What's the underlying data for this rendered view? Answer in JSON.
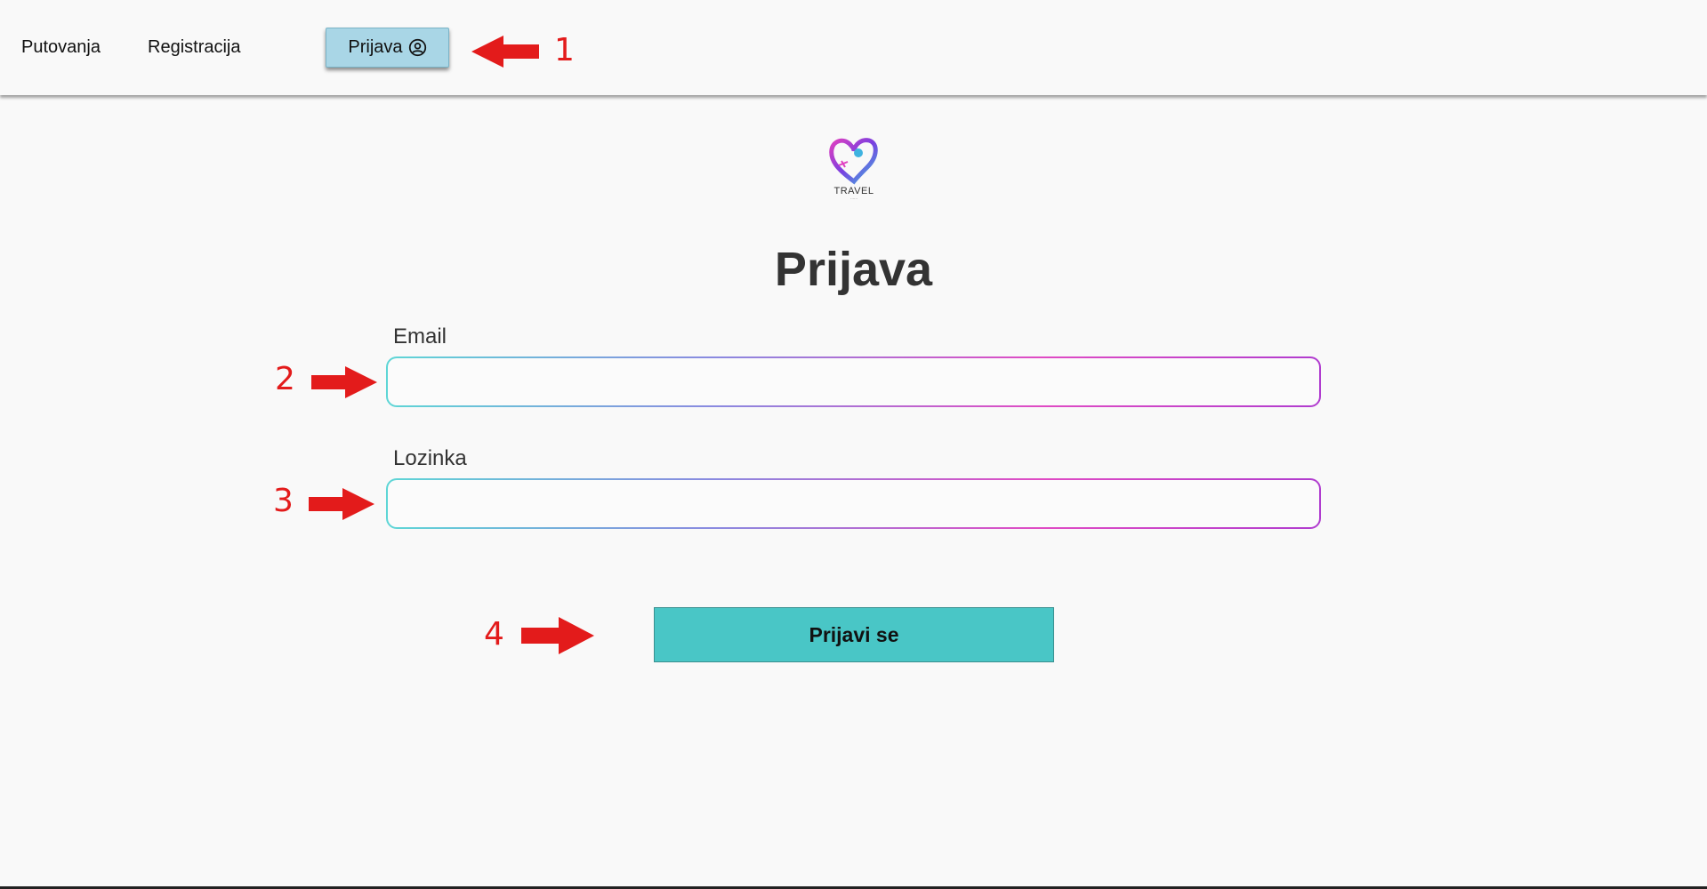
{
  "nav": {
    "travels_label": "Putovanja",
    "register_label": "Registracija",
    "login_label": "Prijava"
  },
  "logo": {
    "text": "TRAVEL"
  },
  "form": {
    "title": "Prijava",
    "email_label": "Email",
    "email_value": "",
    "password_label": "Lozinka",
    "password_value": "",
    "submit_label": "Prijavi se"
  },
  "annotations": {
    "one": "1",
    "two": "2",
    "three": "3",
    "four": "4",
    "color": "#e31b1b"
  },
  "colors": {
    "login_button": "#a9d6e6",
    "submit_button": "#49c6c6",
    "field_gradient_start": "#5ed6d6",
    "field_gradient_end": "#b03ccf"
  }
}
